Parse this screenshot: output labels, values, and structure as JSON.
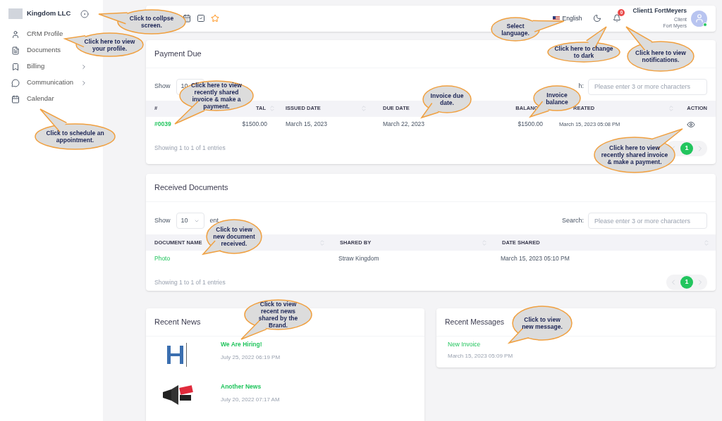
{
  "sidebar": {
    "brand": "Kingdom LLC",
    "items": [
      {
        "label": "CRM Profile",
        "expandable": false
      },
      {
        "label": "Documents",
        "expandable": false
      },
      {
        "label": "Billing",
        "expandable": true
      },
      {
        "label": "Communication",
        "expandable": true
      },
      {
        "label": "Calendar",
        "expandable": false
      }
    ]
  },
  "topbar": {
    "language": "English",
    "notifications": "0",
    "user": {
      "name": "Client1 FortMeyers",
      "role": "Client",
      "location": "Fort Myers",
      "online": true
    }
  },
  "payment_due": {
    "title": "Payment Due",
    "show_label": "Show",
    "page_size": "10",
    "search_label": "h:",
    "search_placeholder": "Please enter 3 or more characters",
    "columns": [
      "#",
      "TAL",
      "ISSUED DATE",
      "DUE DATE",
      "BALANC",
      "REATED",
      "ACTION"
    ],
    "rows": [
      {
        "number": "#0039",
        "total": "$1500.00",
        "issued": "March 15, 2023",
        "due": "March 22, 2023",
        "balance": "$1500.00",
        "created": "March 15, 2023 05:08 PM"
      }
    ],
    "summary": "Showing 1 to 1 of 1 entries",
    "pages": [
      {
        "label": "1",
        "selected": true
      }
    ]
  },
  "received_documents": {
    "title": "Received Documents",
    "show_label": "Show",
    "page_size": "10",
    "entries_label": "ent",
    "search_label": "Search:",
    "search_placeholder": "Please enter 3 or more characters",
    "columns": [
      "DOCUMENT NAME",
      "SHARED BY",
      "DATE SHARED"
    ],
    "rows": [
      {
        "name": "Photo",
        "shared_by": "Straw Kingdom",
        "date": "March 15, 2023 05:10 PM"
      }
    ],
    "summary": "Showing 1 to 1 of 1 entries",
    "pages": [
      {
        "label": "1",
        "selected": true
      }
    ]
  },
  "recent_news": {
    "title": "Recent News",
    "items": [
      {
        "title": "We Are Hiring!",
        "date": "July 25, 2022 06:19 PM"
      },
      {
        "title": "Another News",
        "date": "July 20, 2022 07:17 AM"
      }
    ]
  },
  "recent_messages": {
    "title": "Recent Messages",
    "items": [
      {
        "title": "New Invoice",
        "date": "March 15, 2023 05:09 PM"
      }
    ]
  },
  "callouts": [
    {
      "text": "Click to collpse screen."
    },
    {
      "text": "Click here to view your profile."
    },
    {
      "text": "Click to schedule an appointment."
    },
    {
      "text": "Click here to view recently shared invoice & make a payment."
    },
    {
      "text": "Invoice due date."
    },
    {
      "text": "Invoice balance"
    },
    {
      "text": "Click here to view recently shared invoice & make a payment."
    },
    {
      "text": "Select language."
    },
    {
      "text": "Click here to change to dark"
    },
    {
      "text": "Click here to view notifications."
    },
    {
      "text": "Click to view new document received."
    },
    {
      "text": "Click to view recent news shared by the Brand."
    },
    {
      "text": "Click to view new message."
    }
  ]
}
